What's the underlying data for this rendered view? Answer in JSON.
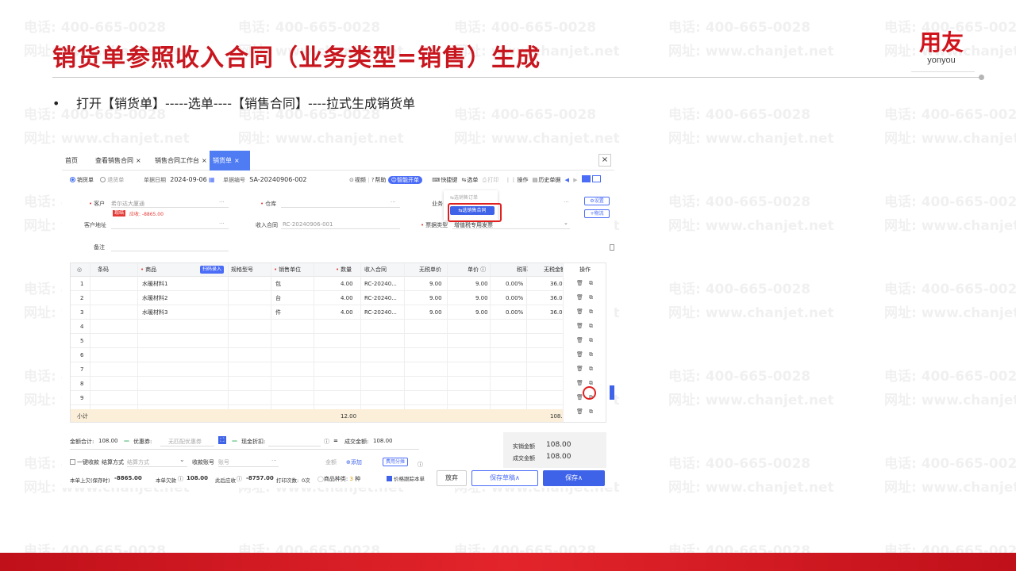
{
  "slide": {
    "title": "销货单参照收入合同（业务类型=销售）生成",
    "logo_cn": "用友",
    "logo_en": "yonyou",
    "bullet": "打开【销货单】-----选单----【销售合同】----拉式生成销货单",
    "watermark_phone": "电话: 400-665-0028",
    "watermark_site": "网址: www.chanjet.net",
    "colors": {
      "brand": "#c8161e",
      "accent": "#3f63e8"
    }
  },
  "app": {
    "tabs": [
      {
        "label": "首页",
        "closable": false
      },
      {
        "label": "查看销售合同",
        "closable": true
      },
      {
        "label": "销售合同工作台",
        "closable": true
      },
      {
        "label": "销货单",
        "closable": true,
        "active": true
      }
    ],
    "close_label": "×",
    "tab_x": "×",
    "doc_type": {
      "option1": "销货单",
      "option2": "退货单"
    },
    "date_label": "单据日期",
    "date_value": "2024-09-06",
    "no_label": "单据编号",
    "no_value": "SA-20240906-002",
    "toolbar": {
      "video": "视频",
      "help": "帮助",
      "smart": "智能开单",
      "shortcut": "快捷键",
      "select": "选单",
      "print": "打印",
      "operation": "操作",
      "history": "历史单据"
    },
    "form": {
      "customer_label": "客户",
      "customer_placeholder": "希尔达大厦通",
      "cash_badge": "现结",
      "receivable": "应收: -8865.00",
      "warehouse_label": "仓库",
      "business_label": "业务",
      "address_label": "客户地址",
      "contract_label": "收入合同",
      "contract_value": "RC-20240906-001",
      "invoice_label": "票据类型",
      "invoice_value": "增值税专用发票",
      "remark_label": "备注",
      "more": "···"
    },
    "dropdown": {
      "item1": "选销售订单",
      "item2": "选销售合同"
    },
    "side": {
      "settings": "设置",
      "logistics": "物流"
    },
    "grid": {
      "headers": {
        "barcode": "条码",
        "product": "商品",
        "scan": "扫码录入",
        "spec": "规格型号",
        "unit": "销售单位",
        "qty": "数量",
        "contract": "收入合同",
        "price_ex": "无税单价",
        "price": "单价",
        "tax": "税率",
        "amount_ex": "无税金额",
        "op": "操作"
      },
      "rows": [
        {
          "no": "1",
          "product": "水暖材料1",
          "unit": "包",
          "qty": "4.00",
          "contract": "RC-20240...",
          "price_ex": "9.00",
          "price": "9.00",
          "tax": "0.00%",
          "amount_ex": "36.0"
        },
        {
          "no": "2",
          "product": "水暖材料2",
          "unit": "台",
          "qty": "4.00",
          "contract": "RC-20240...",
          "price_ex": "9.00",
          "price": "9.00",
          "tax": "0.00%",
          "amount_ex": "36.0"
        },
        {
          "no": "3",
          "product": "水暖材料3",
          "unit": "件",
          "qty": "4.00",
          "contract": "RC-20240...",
          "price_ex": "9.00",
          "price": "9.00",
          "tax": "0.00%",
          "amount_ex": "36.0"
        },
        {
          "no": "4"
        },
        {
          "no": "5"
        },
        {
          "no": "6"
        },
        {
          "no": "7"
        },
        {
          "no": "8"
        },
        {
          "no": "9"
        }
      ],
      "subtotal_label": "小计",
      "subtotal_qty": "12.00",
      "subtotal_amount": "108.0"
    },
    "footer": {
      "total_label": "金额合计:",
      "total_value": "108.00",
      "coupon_label": "优惠券:",
      "coupon_placeholder": "无匹配优惠券",
      "discount_label": "现金折扣:",
      "deal_label": "成交金额:",
      "deal_value": "108.00",
      "one_click": "一键收款",
      "settle_label": "结算方式",
      "settle_placeholder": "结算方式",
      "account_label": "收款账号",
      "account_placeholder": "账号",
      "amount_label": "金额",
      "add": "添加",
      "fee_split": "费用分摊",
      "actual_label": "实销金额",
      "actual_value": "108.00",
      "deal2_label": "成交金额",
      "deal2_value": "108.00",
      "last_owed_label": "本单上欠(保存时)",
      "last_owed_value": "-8865.00",
      "this_owed_label": "本单欠款",
      "this_owed_value": "108.00",
      "after_label": "此后应收",
      "after_value": "-8757.00",
      "print_label": "打印次数:",
      "print_value": "0次",
      "kinds_label": "商品种类:",
      "kinds_value": "3",
      "kinds_unit": "种",
      "trace_label": "价格跟踪本单",
      "discard": "放弃",
      "save_draft": "保存草稿∧",
      "save": "保存∧"
    }
  }
}
